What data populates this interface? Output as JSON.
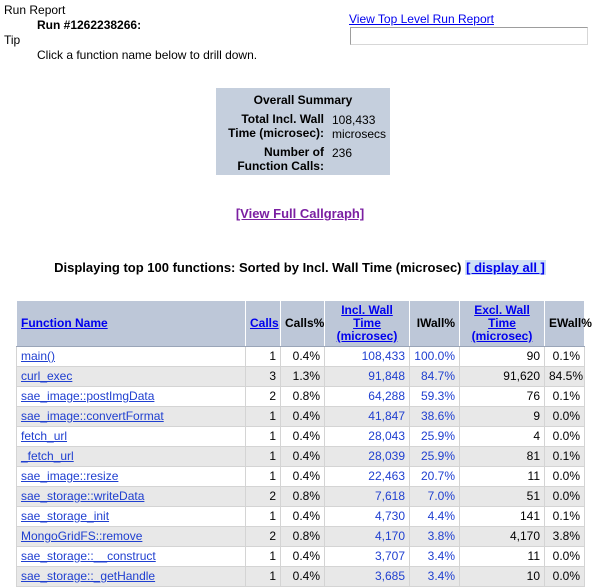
{
  "header": {
    "run_report_label": "Run Report",
    "run_number": "Run #1262238266:",
    "tip_label": "Tip",
    "tip_text": "Click a function name below to drill down.",
    "top_level_link": "View Top Level Run Report",
    "search_value": "",
    "search_placeholder": ""
  },
  "summary": {
    "title": "Overall Summary",
    "rows": [
      {
        "label": "Total Incl. Wall Time (microsec):",
        "value": "108,433 microsecs"
      },
      {
        "label": "Number of Function Calls:",
        "value": "236"
      }
    ],
    "label_1a": "Total Incl. Wall",
    "label_1b": "Time (microsec):",
    "value_1a": "108,433",
    "value_1b": "microsecs",
    "label_2a": "Number of",
    "label_2b": "Function Calls:",
    "value_2": "236",
    "bg_color": "#c5cfdd"
  },
  "callgraph": {
    "link_text": "[View Full Callgraph]",
    "link_color": "#7b1fa2"
  },
  "displaying": {
    "text": "Displaying top 100 functions: Sorted by Incl. Wall Time (microsec)",
    "display_all": "[ display all ]",
    "link_color": "#0000ee",
    "highlight_color": "#cfe0f5"
  },
  "table": {
    "columns": [
      {
        "label": "Function Name",
        "link": true,
        "align": "lt"
      },
      {
        "label": "Calls",
        "link": true,
        "align": "rt"
      },
      {
        "label": "Calls%",
        "link": false,
        "align": "rt"
      },
      {
        "label": "Incl. Wall Time (microsec)",
        "label_line1": "Incl. Wall Time",
        "label_line2": "(microsec)",
        "link": true,
        "align": "ct"
      },
      {
        "label": "IWall%",
        "link": false,
        "align": "rt"
      },
      {
        "label": "Excl. Wall Time (microsec)",
        "label_line1": "Excl. Wall Time",
        "label_line2": "(microsec)",
        "link": true,
        "align": "ct"
      },
      {
        "label": "EWall%",
        "link": false,
        "align": "rt"
      }
    ],
    "rows": [
      {
        "fn": "main()",
        "calls": "1",
        "calls_pct": "0.4%",
        "iwt": "108,433",
        "iwall_pct": "100.0%",
        "ewt": "90",
        "ewall_pct": "0.1%"
      },
      {
        "fn": "curl_exec",
        "calls": "3",
        "calls_pct": "1.3%",
        "iwt": "91,848",
        "iwall_pct": "84.7%",
        "ewt": "91,620",
        "ewall_pct": "84.5%"
      },
      {
        "fn": "sae_image::postImgData",
        "calls": "2",
        "calls_pct": "0.8%",
        "iwt": "64,288",
        "iwall_pct": "59.3%",
        "ewt": "76",
        "ewall_pct": "0.1%"
      },
      {
        "fn": "sae_image::convertFormat",
        "calls": "1",
        "calls_pct": "0.4%",
        "iwt": "41,847",
        "iwall_pct": "38.6%",
        "ewt": "9",
        "ewall_pct": "0.0%"
      },
      {
        "fn": "fetch_url",
        "calls": "1",
        "calls_pct": "0.4%",
        "iwt": "28,043",
        "iwall_pct": "25.9%",
        "ewt": "4",
        "ewall_pct": "0.0%"
      },
      {
        "fn": "_fetch_url",
        "calls": "1",
        "calls_pct": "0.4%",
        "iwt": "28,039",
        "iwall_pct": "25.9%",
        "ewt": "81",
        "ewall_pct": "0.1%"
      },
      {
        "fn": "sae_image::resize",
        "calls": "1",
        "calls_pct": "0.4%",
        "iwt": "22,463",
        "iwall_pct": "20.7%",
        "ewt": "11",
        "ewall_pct": "0.0%"
      },
      {
        "fn": "sae_storage::writeData",
        "calls": "2",
        "calls_pct": "0.8%",
        "iwt": "7,618",
        "iwall_pct": "7.0%",
        "ewt": "51",
        "ewall_pct": "0.0%"
      },
      {
        "fn": "sae_storage_init",
        "calls": "1",
        "calls_pct": "0.4%",
        "iwt": "4,730",
        "iwall_pct": "4.4%",
        "ewt": "141",
        "ewall_pct": "0.1%"
      },
      {
        "fn": "MongoGridFS::remove",
        "calls": "2",
        "calls_pct": "0.8%",
        "iwt": "4,170",
        "iwall_pct": "3.8%",
        "ewt": "4,170",
        "ewall_pct": "3.8%"
      },
      {
        "fn": "sae_storage::__construct",
        "calls": "1",
        "calls_pct": "0.4%",
        "iwt": "3,707",
        "iwall_pct": "3.4%",
        "ewt": "11",
        "ewall_pct": "0.0%"
      },
      {
        "fn": "sae_storage::_getHandle",
        "calls": "1",
        "calls_pct": "0.4%",
        "iwt": "3,685",
        "iwall_pct": "3.4%",
        "ewt": "10",
        "ewall_pct": "0.0%"
      }
    ]
  }
}
